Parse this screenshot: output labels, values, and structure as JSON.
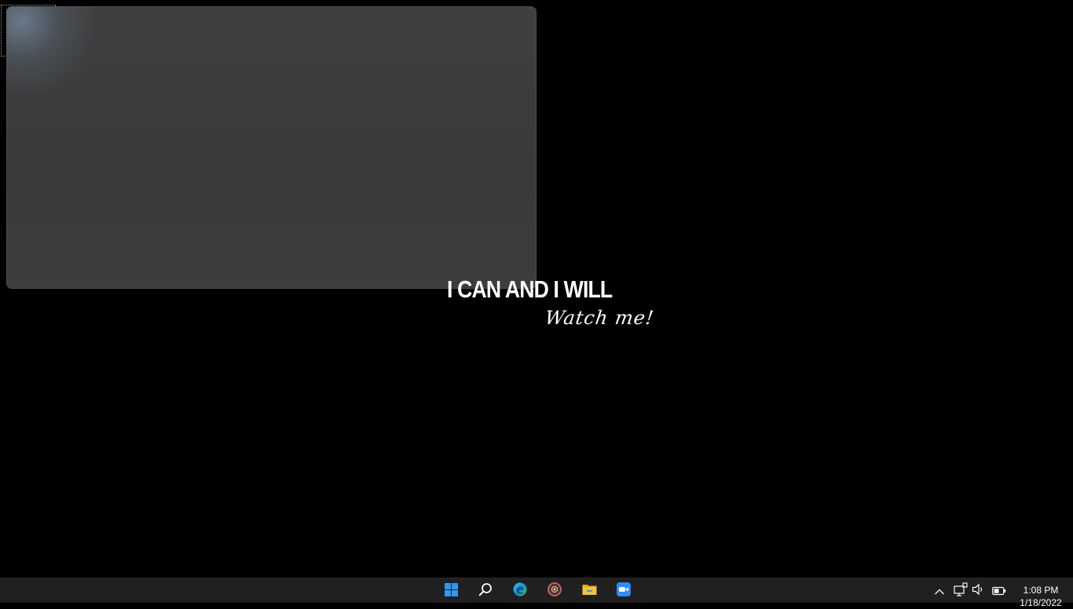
{
  "wallpaper": {
    "quote": "I CAN AND I WILL",
    "signature": "Watch me!"
  },
  "taskbar": {
    "pinned": [
      {
        "name": "start-button",
        "icon": "windows-logo-icon"
      },
      {
        "name": "search-button",
        "icon": "search-icon"
      },
      {
        "name": "edge-button",
        "icon": "edge-icon"
      },
      {
        "name": "media-app-button",
        "icon": "disc-icon"
      },
      {
        "name": "file-explorer-button",
        "icon": "folder-icon"
      },
      {
        "name": "zoom-button",
        "icon": "zoom-video-icon"
      }
    ],
    "tray": {
      "overflow_icon": "chevron-up-icon",
      "network_icon": "network-icon",
      "volume_icon": "speaker-icon",
      "battery_icon": "battery-icon"
    },
    "clock": {
      "time": "1:08 PM",
      "date": "1/18/2022"
    }
  },
  "colors": {
    "desktop_bg": "#000000",
    "taskbar_bg": "#202020",
    "windows_blue": "#2b9af3",
    "folder_yellow": "#f5c33b",
    "zoom_blue": "#2d8cff"
  }
}
